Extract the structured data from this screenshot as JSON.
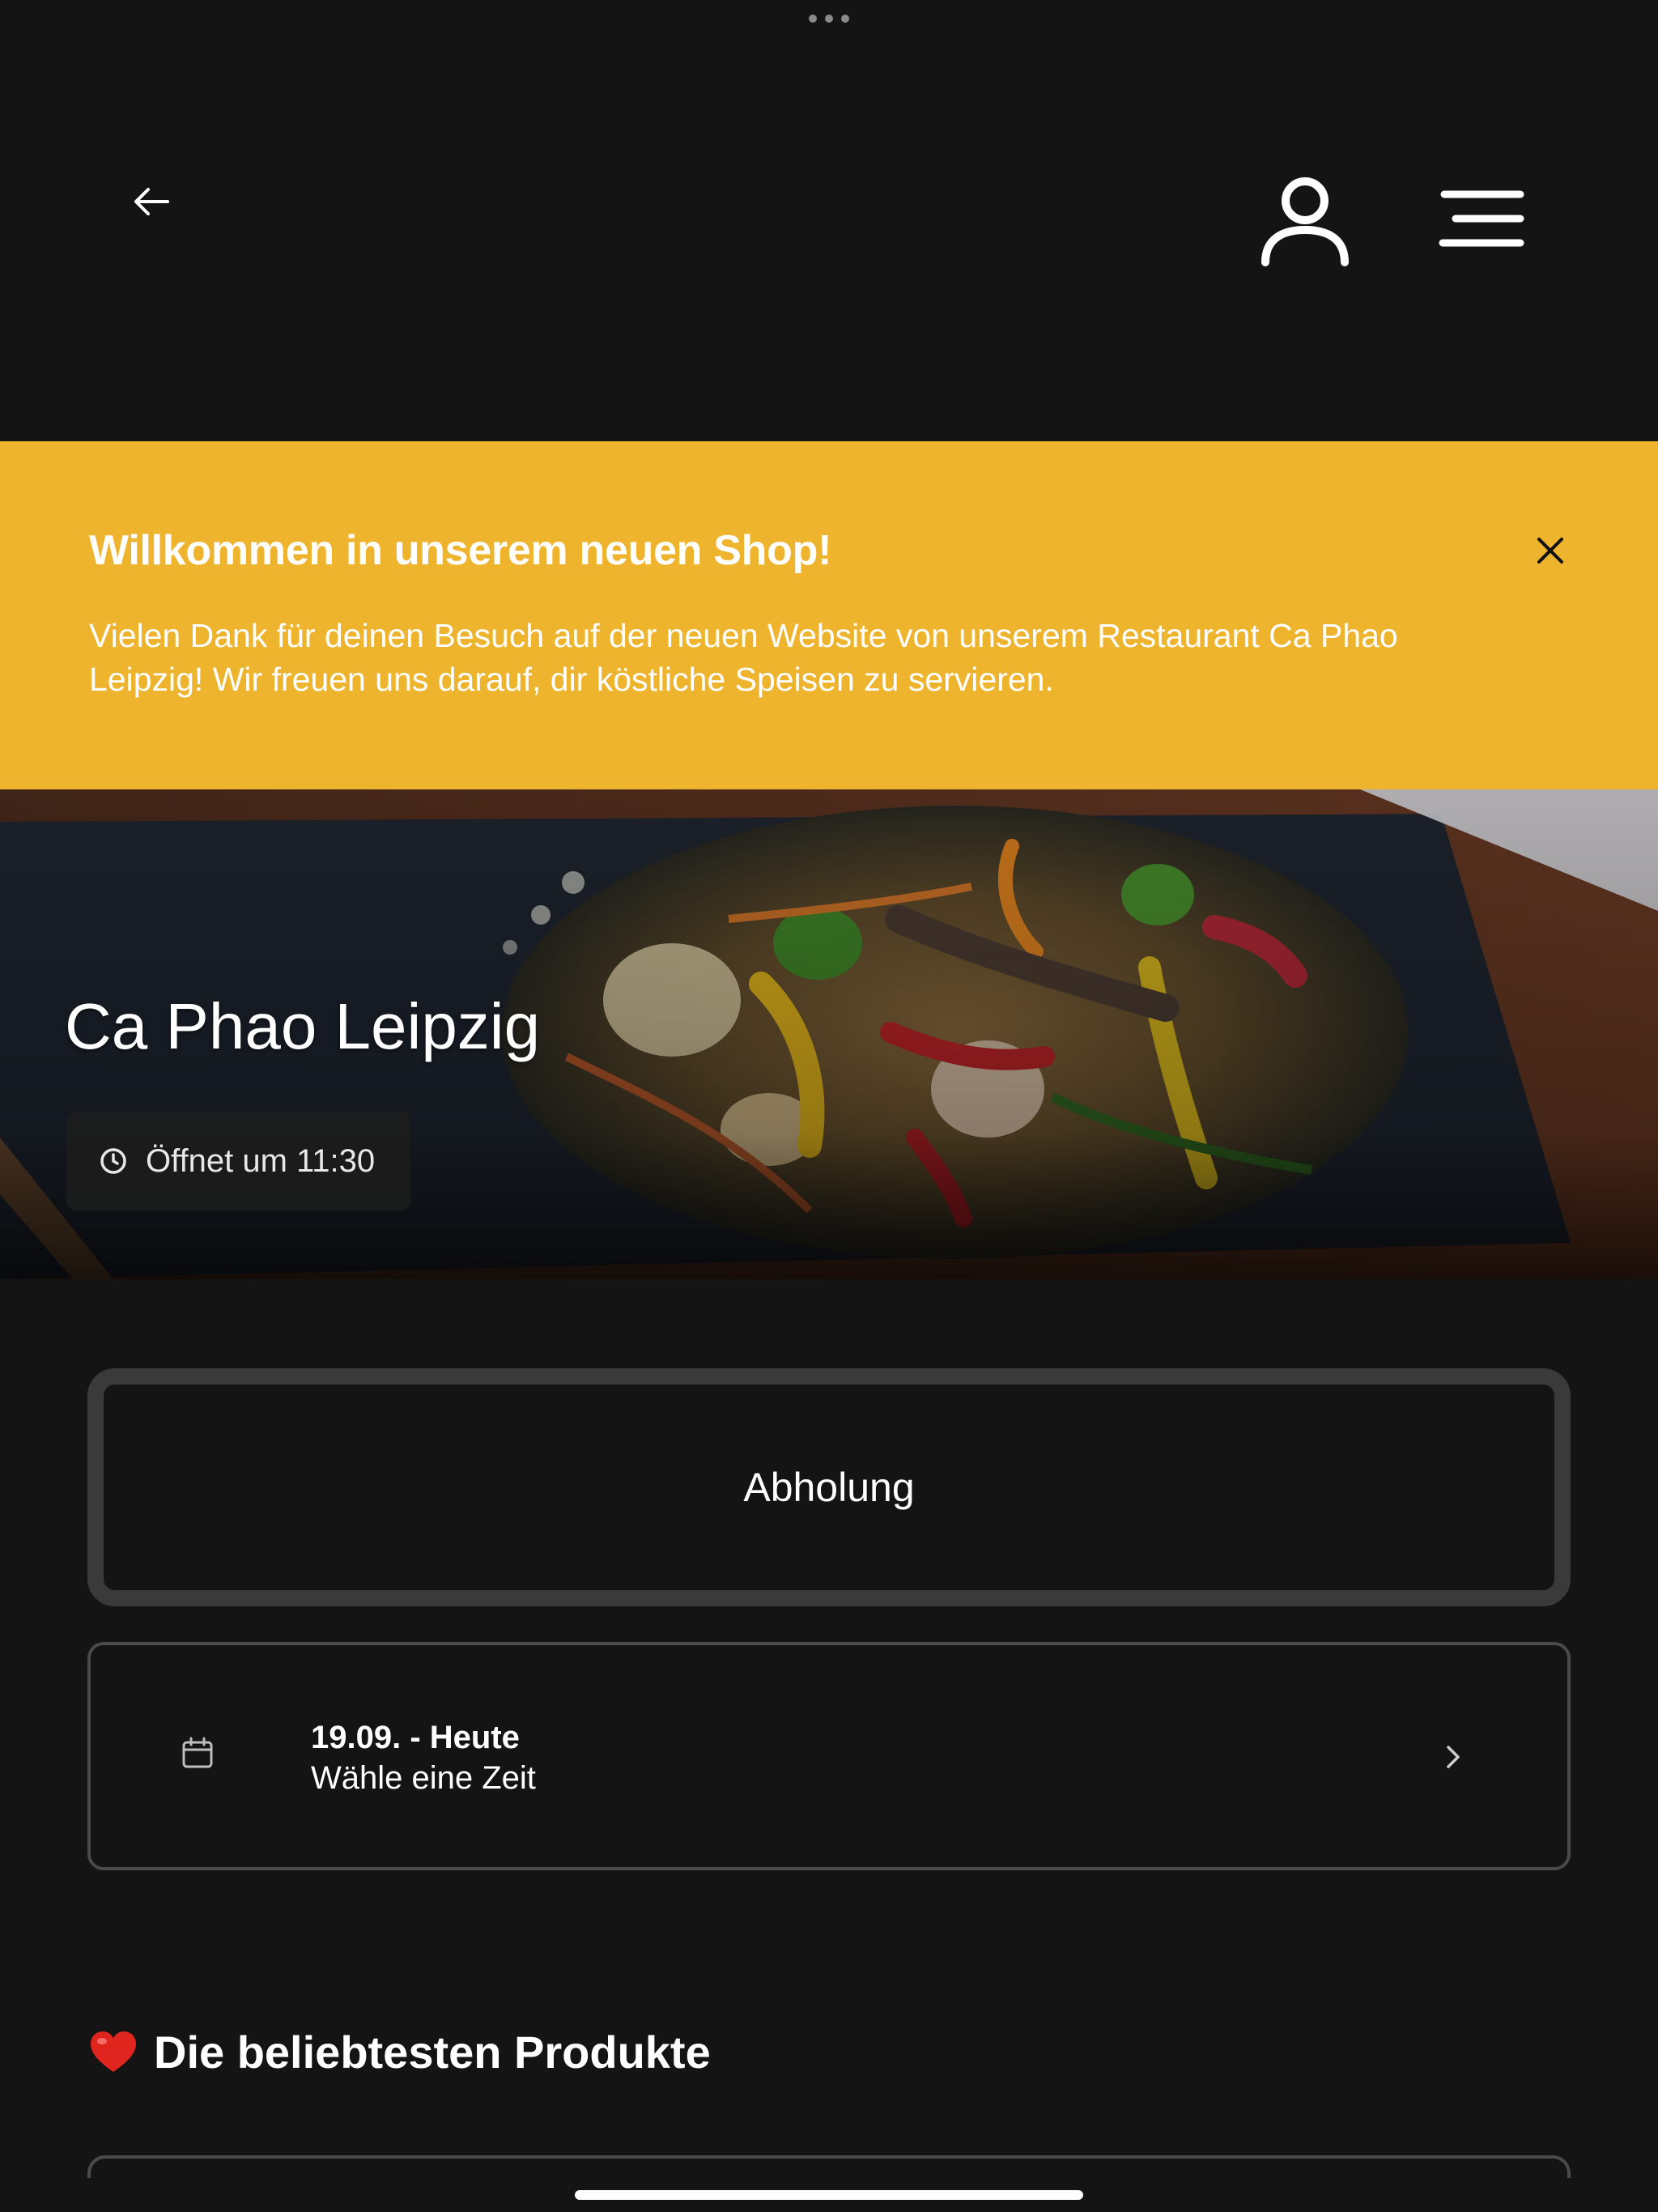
{
  "header": {
    "back_icon": "arrow-left-icon",
    "user_icon": "user-icon",
    "menu_icon": "hamburger-menu-icon"
  },
  "banner": {
    "title": "Willkommen in unserem neuen Shop!",
    "text": "Vielen Dank für deinen Besuch auf der neuen Website von unserem Restaurant Ca Phao Leipzig! Wir freuen uns darauf, dir köstliche Speisen zu servieren.",
    "background_color": "#efb42d",
    "close_icon": "close-icon"
  },
  "hero": {
    "restaurant_name": "Ca Phao Leipzig",
    "opening_status": "Öffnet um 11:30",
    "clock_icon": "clock-icon"
  },
  "order": {
    "mode_label": "Abholung",
    "date_label": "19.09. - Heute",
    "time_prompt": "Wähle eine Zeit",
    "calendar_icon": "calendar-icon",
    "chevron_icon": "chevron-right-icon"
  },
  "popular": {
    "emoji": "❤️",
    "title": "Die beliebtesten Produkte"
  }
}
